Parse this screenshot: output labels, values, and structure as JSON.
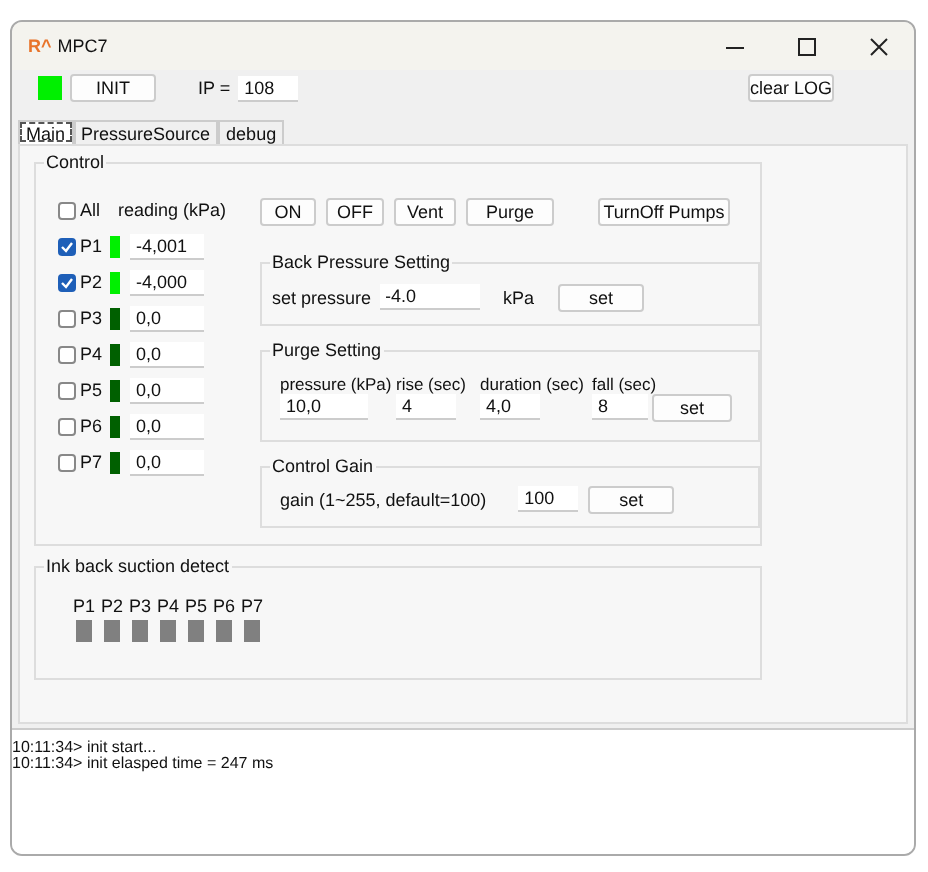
{
  "window": {
    "logo": "R^",
    "title": "MPC7"
  },
  "toolbar": {
    "connected": true,
    "init_button": "INIT",
    "ip_label": "IP =",
    "ip_value": "108",
    "clear_button": "clear LOG"
  },
  "tabs": [
    {
      "label": "Main",
      "selected": true
    },
    {
      "label": "PressureSource",
      "selected": false
    },
    {
      "label": "debug",
      "selected": false
    }
  ],
  "control": {
    "title": "Control",
    "all": {
      "label": "All",
      "checked": false
    },
    "reading_header": "reading (kPa)",
    "channels": [
      {
        "label": "P1",
        "checked": true,
        "active": true,
        "reading": "-4,001"
      },
      {
        "label": "P2",
        "checked": true,
        "active": true,
        "reading": "-4,000"
      },
      {
        "label": "P3",
        "checked": false,
        "active": false,
        "reading": "0,0"
      },
      {
        "label": "P4",
        "checked": false,
        "active": false,
        "reading": "0,0"
      },
      {
        "label": "P5",
        "checked": false,
        "active": false,
        "reading": "0,0"
      },
      {
        "label": "P6",
        "checked": false,
        "active": false,
        "reading": "0,0"
      },
      {
        "label": "P7",
        "checked": false,
        "active": false,
        "reading": "0,0"
      }
    ],
    "buttons": [
      "ON",
      "OFF",
      "Vent",
      "Purge"
    ],
    "turnoff_button": "TurnOff Pumps",
    "back_pressure": {
      "title": "Back Pressure Setting",
      "label": "set pressure",
      "value": "-4.0",
      "unit": "kPa",
      "button": "set"
    },
    "purge": {
      "title": "Purge Setting",
      "fields": [
        {
          "label": "pressure (kPa)",
          "value": "10,0"
        },
        {
          "label": "rise (sec)",
          "value": "4"
        },
        {
          "label": "duration (sec)",
          "value": "4,0"
        },
        {
          "label": "fall (sec)",
          "value": "8"
        }
      ],
      "button": "set"
    },
    "gain": {
      "title": "Control Gain",
      "label": "gain (1~255, default=100)",
      "value": "100",
      "button": "set"
    }
  },
  "ink_detect": {
    "title": "Ink back suction detect",
    "channels": [
      {
        "label": "P1",
        "detected": false
      },
      {
        "label": "P2",
        "detected": false
      },
      {
        "label": "P3",
        "detected": false
      },
      {
        "label": "P4",
        "detected": false
      },
      {
        "label": "P5",
        "detected": false
      },
      {
        "label": "P6",
        "detected": false
      },
      {
        "label": "P7",
        "detected": false
      }
    ]
  },
  "log": [
    "10:11:34> init start...",
    "10:11:34> init elasped time = 247 ms"
  ]
}
